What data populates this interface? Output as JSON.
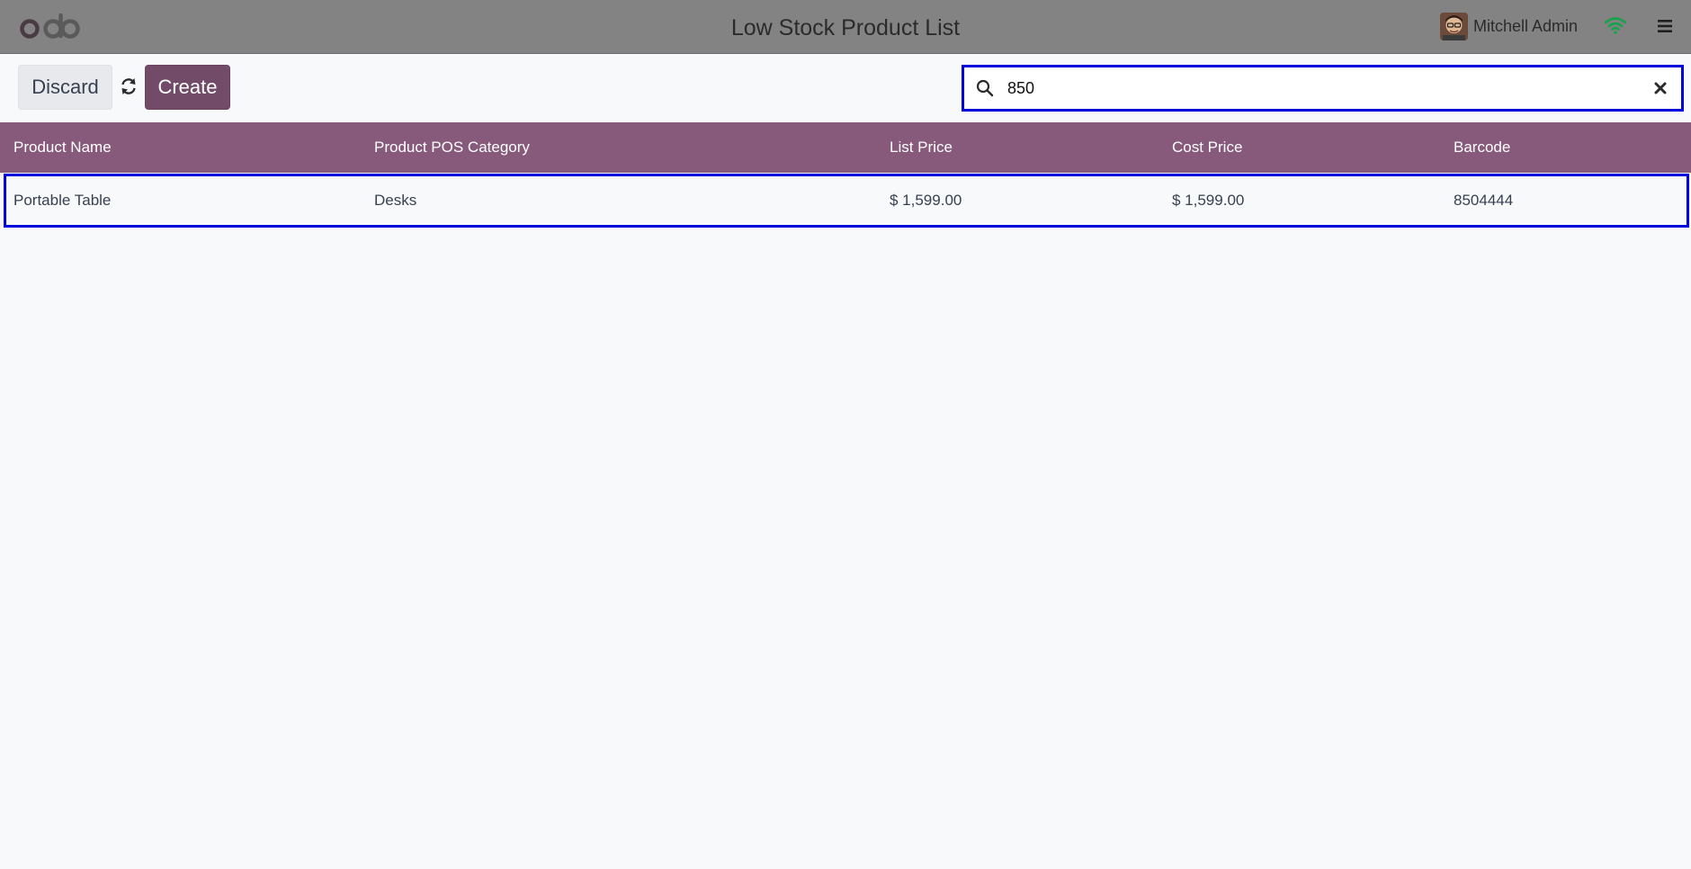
{
  "header": {
    "logo_text": "odoo",
    "title": "Low Stock Product List",
    "user_name": "Mitchell Admin",
    "wifi_icon": "wifi-icon",
    "menu_icon": "hamburger-menu-icon"
  },
  "controls": {
    "discard_label": "Discard",
    "reload_icon": "refresh-icon",
    "create_label": "Create"
  },
  "search": {
    "value": "850",
    "search_icon": "search-icon",
    "clear_icon": "close-icon"
  },
  "table": {
    "columns": [
      "Product Name",
      "Product POS Category",
      "List Price",
      "Cost Price",
      "Barcode"
    ],
    "rows": [
      {
        "product_name": "Portable Table",
        "pos_category": "Desks",
        "list_price": "$ 1,599.00",
        "cost_price": "$ 1,599.00",
        "barcode": "8504444"
      }
    ]
  },
  "colors": {
    "topbar": "#838383",
    "brand": "#714b67",
    "table_header": "#875a7b",
    "highlight": "#0000dd",
    "wifi": "#16a34a"
  }
}
